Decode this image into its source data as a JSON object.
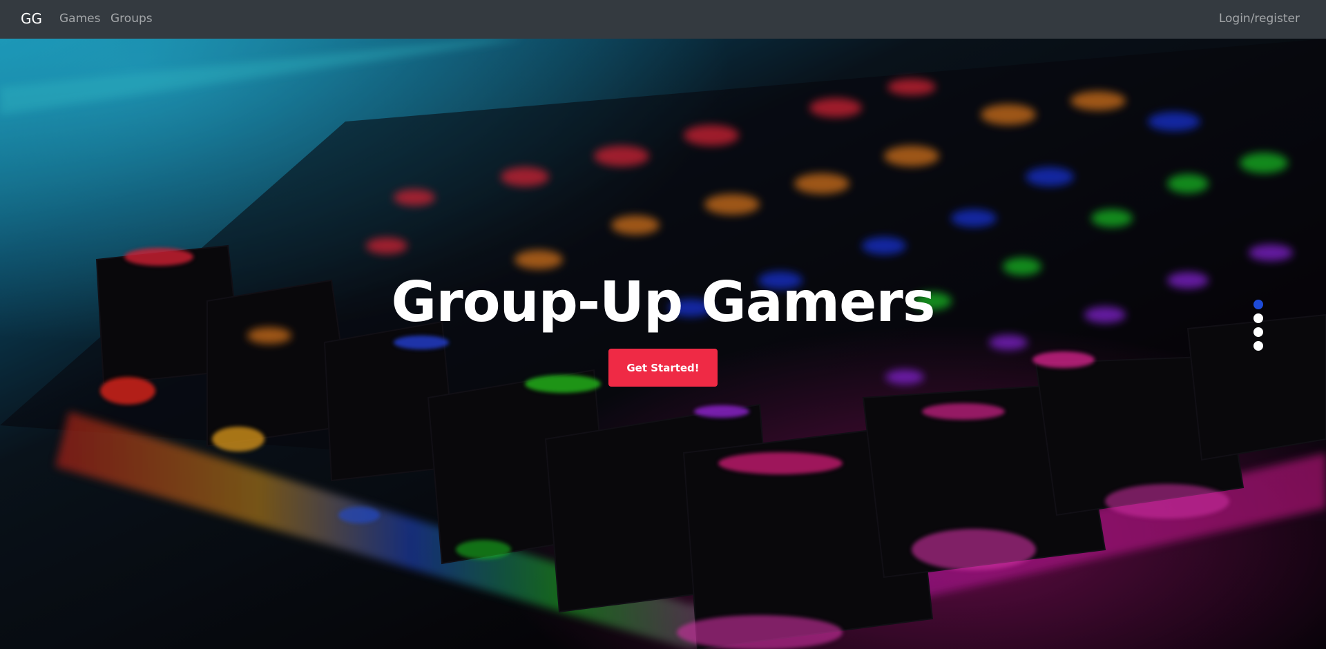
{
  "navbar": {
    "brand": "GG",
    "links": [
      "Games",
      "Groups"
    ],
    "login_label": "Login/register"
  },
  "hero": {
    "title": "Group-Up Gamers",
    "cta_label": "Get Started!",
    "carousel": {
      "slides": 4,
      "active_index": 0
    }
  },
  "colors": {
    "navbar_bg": "#343a40",
    "cta_bg": "#ef2a45",
    "active_indicator": "#1e4bd8"
  }
}
